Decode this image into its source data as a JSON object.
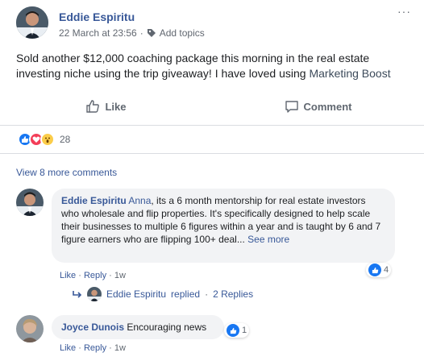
{
  "post": {
    "author": "Eddie Espiritu",
    "timestamp": "22 March at 23:56",
    "meta_separator": "·",
    "add_topics": "Add topics",
    "more_menu": "···",
    "text_main": "Sold another $12,000 coaching package this morning in the real estate investing niche using the trip giveaway! I have loved using ",
    "text_highlight": "Marketing Boost"
  },
  "actions": {
    "like": "Like",
    "comment": "Comment"
  },
  "reactions": {
    "count": "28",
    "types": [
      "like-icon",
      "love-icon",
      "wow-icon"
    ]
  },
  "view_more_comments": "View 8 more comments",
  "comments": [
    {
      "author": "Eddie Espiritu",
      "mention": "Anna",
      "text": ", its a 6 month mentorship for real estate investors who wholesale and flip properties. It's specifically designed to help scale their businesses to multiple 6 figures within a year and is taught by 6 and 7 figure earners who are flipping 100+ deal",
      "ellipsis": "...",
      "see_more": "See more",
      "like": "Like",
      "reply": "Reply",
      "sep": "·",
      "time": "1w",
      "reaction_count": "4"
    },
    {
      "author": "Joyce Dunois",
      "text": "Encouraging news",
      "like": "Like",
      "reply": "Reply",
      "sep": "·",
      "time": "1w",
      "reaction_count": "1"
    }
  ],
  "replies": {
    "author": "Eddie Espiritu",
    "action": "replied",
    "sep": "·",
    "count_label": "2 Replies"
  },
  "colors": {
    "link": "#385898",
    "like_blue": "#1877f2",
    "love_red": "#f33e58",
    "wow_yellow": "#fbcd4a",
    "muted": "#606770",
    "bubble_bg": "#f2f3f5"
  }
}
